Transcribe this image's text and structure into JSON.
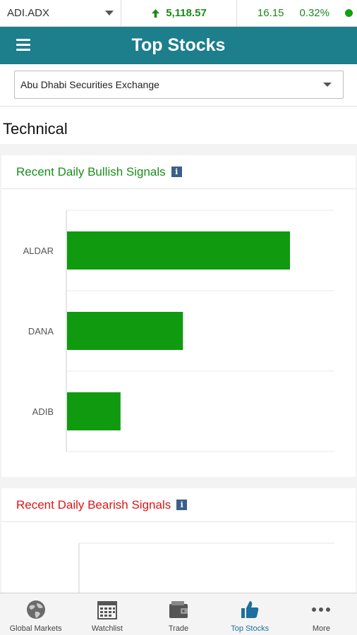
{
  "ticker": {
    "symbol": "ADI.ADX",
    "index_value": "5,118.57",
    "change": "16.15",
    "change_pct": "0.32%",
    "status_color": "#12a012"
  },
  "appbar": {
    "title": "Top Stocks"
  },
  "exchange_select": {
    "value": "Abu Dhabi Securities Exchange"
  },
  "section": {
    "title": "Technical"
  },
  "bullish": {
    "title": "Recent Daily Bullish Signals",
    "info": "i",
    "color": "#1b8e1b"
  },
  "bearish": {
    "title": "Recent Daily Bearish Signals",
    "info": "i",
    "color": "#e01414"
  },
  "chart_data": [
    {
      "type": "bar",
      "orientation": "horizontal",
      "categories": [
        "ALDAR",
        "DANA",
        "ADIB"
      ],
      "values": [
        100,
        52,
        24
      ],
      "bar_color": "#0f9a0f",
      "grid": true
    }
  ],
  "bottom_nav": {
    "items": [
      {
        "label": "Global Markets",
        "icon": "globe-icon"
      },
      {
        "label": "Watchlist",
        "icon": "calendar-grid-icon"
      },
      {
        "label": "Trade",
        "icon": "wallet-icon"
      },
      {
        "label": "Top Stocks",
        "icon": "thumbs-up-icon",
        "active": true
      },
      {
        "label": "More",
        "icon": "more-dots-icon"
      }
    ]
  }
}
